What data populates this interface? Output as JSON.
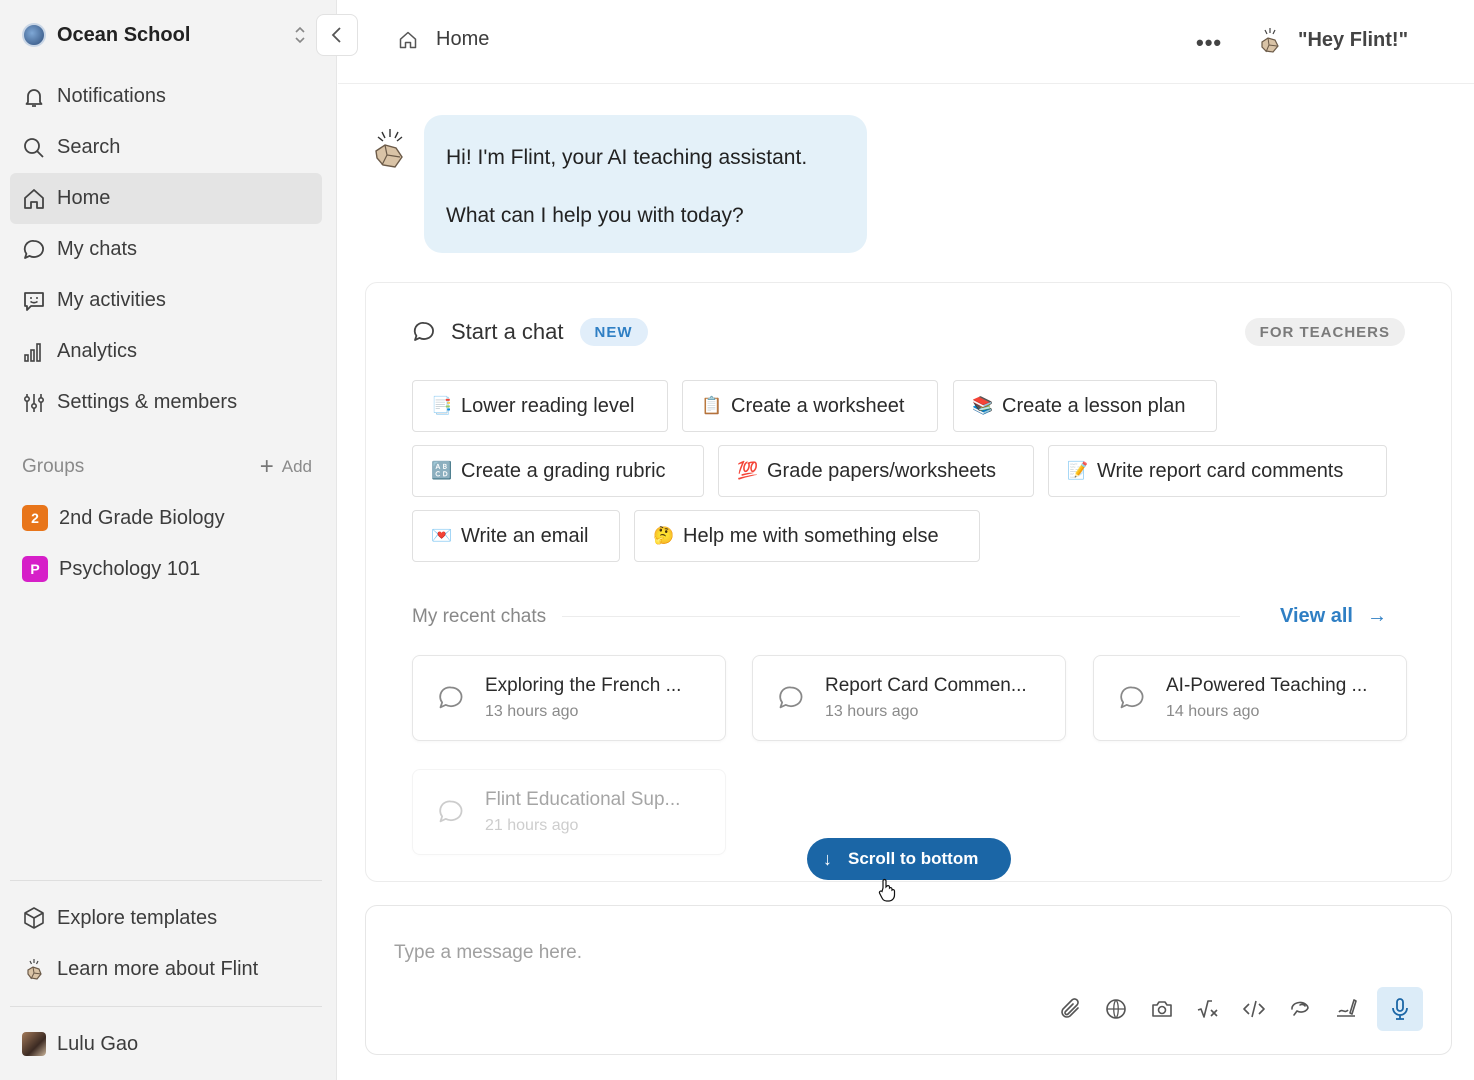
{
  "workspace": {
    "name": "Ocean School"
  },
  "sidebar": {
    "nav": [
      {
        "label": "Notifications",
        "icon": "bell-icon"
      },
      {
        "label": "Search",
        "icon": "search-icon"
      },
      {
        "label": "Home",
        "icon": "home-icon",
        "active": true
      },
      {
        "label": "My chats",
        "icon": "chat-bubble-icon"
      },
      {
        "label": "My activities",
        "icon": "activity-smile-icon"
      },
      {
        "label": "Analytics",
        "icon": "bar-chart-icon"
      },
      {
        "label": "Settings & members",
        "icon": "sliders-icon"
      }
    ],
    "groups_label": "Groups",
    "add_label": "Add",
    "groups": [
      {
        "badge": "2",
        "name": "2nd Grade Biology",
        "color": "#e8751a"
      },
      {
        "badge": "P",
        "name": "Psychology 101",
        "color": "#d61fc8"
      }
    ],
    "explore_label": "Explore templates",
    "learn_label": "Learn more about Flint",
    "user_name": "Lulu Gao"
  },
  "topbar": {
    "title": "Home",
    "more": "•••",
    "hey_flint": "\"Hey Flint!\""
  },
  "greeting": {
    "line1": "Hi! I'm Flint, your AI teaching assistant.",
    "line2": "What can I help you with today?"
  },
  "start_chat": {
    "title": "Start a chat",
    "new_badge": "NEW",
    "teachers_badge": "FOR TEACHERS",
    "chips": [
      {
        "emoji": "📑",
        "label": "Lower reading level"
      },
      {
        "emoji": "📋",
        "label": "Create a worksheet"
      },
      {
        "emoji": "📚",
        "label": "Create a lesson plan"
      },
      {
        "emoji": "🔠",
        "label": "Create a grading rubric"
      },
      {
        "emoji": "💯",
        "label": "Grade papers/worksheets"
      },
      {
        "emoji": "📝",
        "label": "Write report card comments"
      },
      {
        "emoji": "💌",
        "label": "Write an email"
      },
      {
        "emoji": "🤔",
        "label": "Help me with something else"
      }
    ]
  },
  "recent": {
    "label": "My recent chats",
    "view_all": "View all",
    "chats": [
      {
        "title": "Exploring the French ...",
        "time": "13 hours ago"
      },
      {
        "title": "Report Card Commen...",
        "time": "13 hours ago"
      },
      {
        "title": "AI-Powered Teaching ...",
        "time": "14 hours ago"
      },
      {
        "title": "Flint Educational Sup...",
        "time": "21 hours ago"
      }
    ]
  },
  "scroll_button": "Scroll to bottom",
  "composer": {
    "placeholder": "Type a message here.",
    "tools": [
      "paperclip-icon",
      "globe-www-icon",
      "camera-icon",
      "math-sqrt-icon",
      "code-icon",
      "brain-icon",
      "drawing-icon",
      "microphone-icon"
    ]
  },
  "colors": {
    "accent": "#1b66a6",
    "link": "#2f7fc4",
    "bubble": "#e4f1f9"
  }
}
